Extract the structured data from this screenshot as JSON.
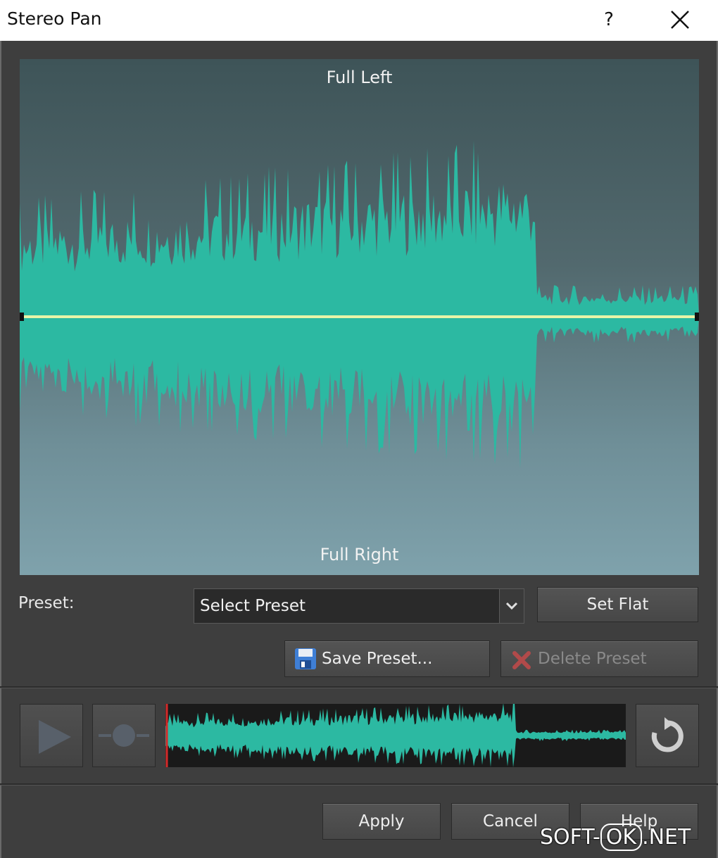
{
  "window": {
    "title": "Stereo Pan",
    "help_glyph": "?"
  },
  "graph": {
    "top_label": "Full Left",
    "bottom_label": "Full Right"
  },
  "preset": {
    "label": "Preset:",
    "selected": "Select Preset",
    "set_flat": "Set Flat",
    "save": "Save Preset...",
    "delete": "Delete Preset"
  },
  "actions": {
    "apply": "Apply",
    "cancel": "Cancel",
    "help": "Help"
  },
  "watermark": {
    "prefix": "SOFT-",
    "ok": "OK",
    "suffix": ".NET"
  },
  "colors": {
    "waveform": "#2cb9a2",
    "pan_line": "#e8f5a8",
    "background": "#3d3d3d",
    "overview_bg": "#1a1a1a"
  },
  "icons": {
    "play": "play-icon",
    "record": "record-icon",
    "loop": "loop-icon",
    "save": "floppy-icon",
    "delete": "x-icon"
  }
}
